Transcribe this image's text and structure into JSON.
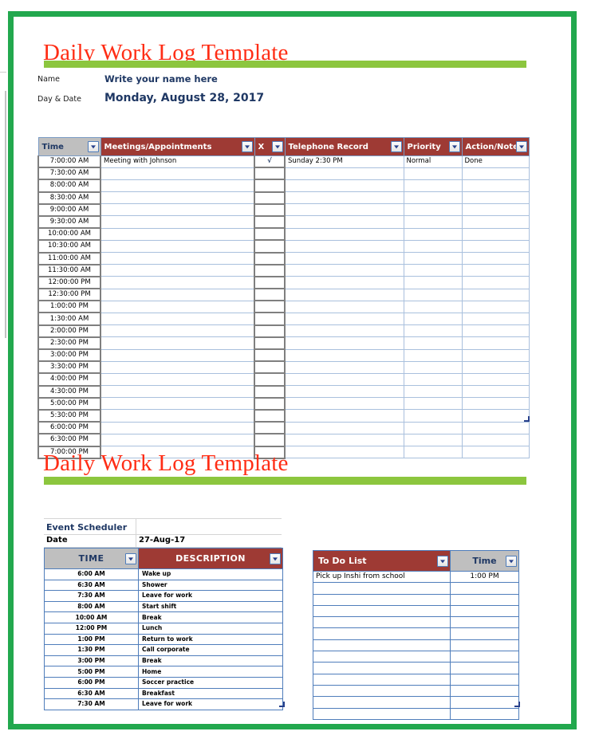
{
  "theme": {
    "frame_green": "#22a84e",
    "bar_green": "#8cc63e",
    "title_red": "#ff2d15",
    "header_red": "#9e3a34",
    "header_gray": "#bfbfbf",
    "navy_text": "#1f3864"
  },
  "section1": {
    "title": "Daily Work Log Template",
    "name_label": "Name",
    "name_value": "Write your name here",
    "date_label": "Day & Date",
    "date_value": "Monday, August 28, 2017",
    "columns": [
      {
        "key": "time",
        "label": "Time",
        "style": "gray"
      },
      {
        "key": "meetings",
        "label": "Meetings/Appointments",
        "style": "red"
      },
      {
        "key": "x",
        "label": "X",
        "style": "red"
      },
      {
        "key": "telephone",
        "label": "Telephone Record",
        "style": "red"
      },
      {
        "key": "priority",
        "label": "Priority",
        "style": "red"
      },
      {
        "key": "action",
        "label": "Action/Notes",
        "style": "red"
      }
    ],
    "rows": [
      {
        "time": "7:00:00 AM",
        "meetings": "Meeting with Johnson",
        "x": "√",
        "telephone": "Sunday 2:30 PM",
        "priority": "Normal",
        "action": "Done"
      },
      {
        "time": "7:30:00 AM",
        "meetings": "",
        "x": "",
        "telephone": "",
        "priority": "",
        "action": ""
      },
      {
        "time": "8:00:00 AM",
        "meetings": "",
        "x": "",
        "telephone": "",
        "priority": "",
        "action": ""
      },
      {
        "time": "8:30:00 AM",
        "meetings": "",
        "x": "",
        "telephone": "",
        "priority": "",
        "action": ""
      },
      {
        "time": "9:00:00 AM",
        "meetings": "",
        "x": "",
        "telephone": "",
        "priority": "",
        "action": ""
      },
      {
        "time": "9:30:00 AM",
        "meetings": "",
        "x": "",
        "telephone": "",
        "priority": "",
        "action": ""
      },
      {
        "time": "10:00:00 AM",
        "meetings": "",
        "x": "",
        "telephone": "",
        "priority": "",
        "action": ""
      },
      {
        "time": "10:30:00 AM",
        "meetings": "",
        "x": "",
        "telephone": "",
        "priority": "",
        "action": ""
      },
      {
        "time": "11:00:00 AM",
        "meetings": "",
        "x": "",
        "telephone": "",
        "priority": "",
        "action": ""
      },
      {
        "time": "11:30:00 AM",
        "meetings": "",
        "x": "",
        "telephone": "",
        "priority": "",
        "action": ""
      },
      {
        "time": "12:00:00 PM",
        "meetings": "",
        "x": "",
        "telephone": "",
        "priority": "",
        "action": ""
      },
      {
        "time": "12:30:00 PM",
        "meetings": "",
        "x": "",
        "telephone": "",
        "priority": "",
        "action": ""
      },
      {
        "time": "1:00:00 PM",
        "meetings": "",
        "x": "",
        "telephone": "",
        "priority": "",
        "action": ""
      },
      {
        "time": "1:30:00 AM",
        "meetings": "",
        "x": "",
        "telephone": "",
        "priority": "",
        "action": ""
      },
      {
        "time": "2:00:00 PM",
        "meetings": "",
        "x": "",
        "telephone": "",
        "priority": "",
        "action": ""
      },
      {
        "time": "2:30:00 PM",
        "meetings": "",
        "x": "",
        "telephone": "",
        "priority": "",
        "action": ""
      },
      {
        "time": "3:00:00 PM",
        "meetings": "",
        "x": "",
        "telephone": "",
        "priority": "",
        "action": ""
      },
      {
        "time": "3:30:00 PM",
        "meetings": "",
        "x": "",
        "telephone": "",
        "priority": "",
        "action": ""
      },
      {
        "time": "4:00:00 PM",
        "meetings": "",
        "x": "",
        "telephone": "",
        "priority": "",
        "action": ""
      },
      {
        "time": "4:30:00 PM",
        "meetings": "",
        "x": "",
        "telephone": "",
        "priority": "",
        "action": ""
      },
      {
        "time": "5:00:00 PM",
        "meetings": "",
        "x": "",
        "telephone": "",
        "priority": "",
        "action": ""
      },
      {
        "time": "5:30:00 PM",
        "meetings": "",
        "x": "",
        "telephone": "",
        "priority": "",
        "action": ""
      },
      {
        "time": "6:00:00 PM",
        "meetings": "",
        "x": "",
        "telephone": "",
        "priority": "",
        "action": ""
      },
      {
        "time": "6:30:00 PM",
        "meetings": "",
        "x": "",
        "telephone": "",
        "priority": "",
        "action": ""
      },
      {
        "time": "7:00:00 PM",
        "meetings": "",
        "x": "",
        "telephone": "",
        "priority": "",
        "action": ""
      }
    ]
  },
  "section2": {
    "title": "Daily Work Log Template",
    "event_scheduler": {
      "heading": "Event Scheduler",
      "date_label": "Date",
      "date_value": "27-Aug-17",
      "columns": [
        {
          "key": "time",
          "label": "TIME",
          "style": "gray"
        },
        {
          "key": "description",
          "label": "DESCRIPTION",
          "style": "red"
        }
      ],
      "rows": [
        {
          "time": "6:00 AM",
          "description": "Wake up"
        },
        {
          "time": "6:30 AM",
          "description": "Shower"
        },
        {
          "time": "7:30 AM",
          "description": "Leave for work"
        },
        {
          "time": "8:00 AM",
          "description": "Start shift"
        },
        {
          "time": "10:00 AM",
          "description": "Break"
        },
        {
          "time": "12:00 PM",
          "description": "Lunch"
        },
        {
          "time": "1:00 PM",
          "description": "Return to work"
        },
        {
          "time": "1:30 PM",
          "description": "Call corporate"
        },
        {
          "time": "3:00 PM",
          "description": "Break"
        },
        {
          "time": "5:00 PM",
          "description": "Home"
        },
        {
          "time": "6:00 PM",
          "description": "Soccer practice"
        },
        {
          "time": "6:30 AM",
          "description": "Breakfast"
        },
        {
          "time": "7:30 AM",
          "description": "Leave for work"
        }
      ]
    },
    "todo": {
      "columns": [
        {
          "key": "task",
          "label": "To Do List",
          "style": "red"
        },
        {
          "key": "time",
          "label": "Time",
          "style": "gray"
        }
      ],
      "rows": [
        {
          "task": "Pick up Inshi from school",
          "time": "1:00 PM"
        },
        {
          "task": "",
          "time": ""
        },
        {
          "task": "",
          "time": ""
        },
        {
          "task": "",
          "time": ""
        },
        {
          "task": "",
          "time": ""
        },
        {
          "task": "",
          "time": ""
        },
        {
          "task": "",
          "time": ""
        },
        {
          "task": "",
          "time": ""
        },
        {
          "task": "",
          "time": ""
        },
        {
          "task": "",
          "time": ""
        },
        {
          "task": "",
          "time": ""
        },
        {
          "task": "",
          "time": ""
        },
        {
          "task": "",
          "time": ""
        }
      ]
    }
  },
  "icons": {
    "filter_dropdown": "chevron-down-icon"
  }
}
